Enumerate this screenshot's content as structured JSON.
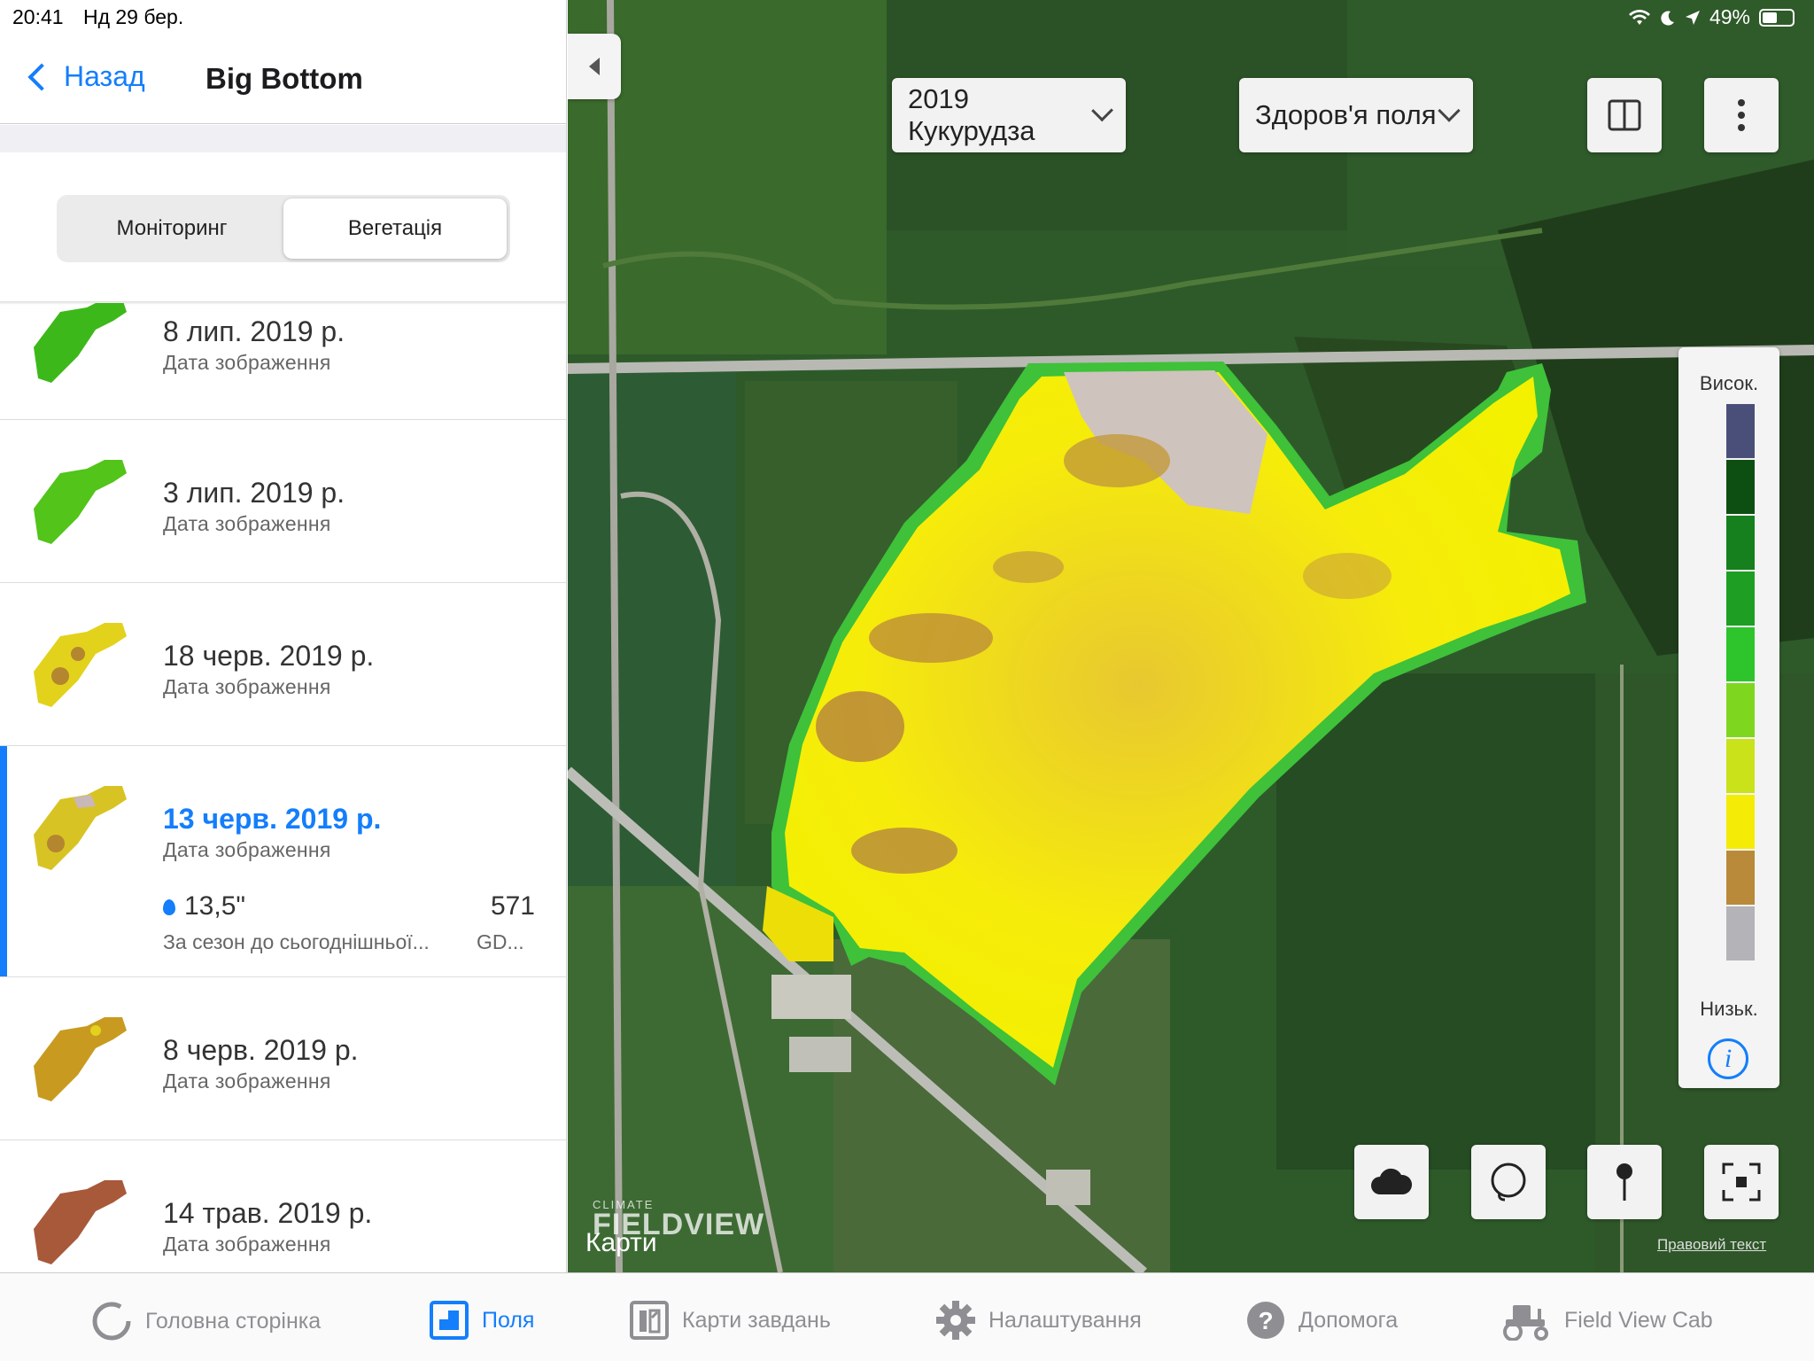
{
  "status": {
    "time": "20:41",
    "date": "Нд 29 бер.",
    "battery": "49%"
  },
  "nav": {
    "back_label": "Назад",
    "title": "Big Bottom"
  },
  "segments": {
    "monitoring": "Моніторинг",
    "vegetation": "Вегетація"
  },
  "images": [
    {
      "date": "8 лип. 2019 р.",
      "label": "Дата зображення",
      "tint": "#3db81a"
    },
    {
      "date": "3 лип. 2019 р.",
      "label": "Дата зображення",
      "tint": "#52c41a"
    },
    {
      "date": "18 черв. 2019 р.",
      "label": "Дата зображення",
      "tint": "#e2d21c"
    },
    {
      "date": "13 черв. 2019 р.",
      "label": "Дата зображення",
      "tint": "#d8c324",
      "rain_value": "13,5\"",
      "rain_label": "За сезон до сьогоднішньої...",
      "gdd_value": "571",
      "gdd_label": "GD..."
    },
    {
      "date": "8 черв. 2019 р.",
      "label": "Дата зображення",
      "tint": "#c99a20"
    },
    {
      "date": "14 трав. 2019 р.",
      "label": "Дата зображення",
      "tint": "#a8593a"
    }
  ],
  "map": {
    "season_select": "2019 Кукурудза",
    "layer_select": "Здоров'я поля",
    "legend_high": "Висок.",
    "legend_low": "Низьк.",
    "legend_colors": [
      "#4a4f7a",
      "#0d4f12",
      "#15801d",
      "#1e9e22",
      "#2ec42c",
      "#7fd61f",
      "#c9e21a",
      "#f4ec07",
      "#b98a3a",
      "#b3b3b8"
    ],
    "info_glyph": "i",
    "brand_top": "CLIMATE",
    "brand_main": "FIELDVIEW",
    "maps_label": "Карти",
    "legal_link": "Правовий текст"
  },
  "tabs": [
    {
      "label": "Головна сторінка",
      "icon": "home-ring-icon"
    },
    {
      "label": "Поля",
      "icon": "fields-icon",
      "active": true
    },
    {
      "label": "Карти завдань",
      "icon": "prescription-icon"
    },
    {
      "label": "Налаштування",
      "icon": "gear-icon"
    },
    {
      "label": "Допомога",
      "icon": "help-icon"
    },
    {
      "label": "Field View Cab",
      "icon": "tractor-icon"
    }
  ]
}
